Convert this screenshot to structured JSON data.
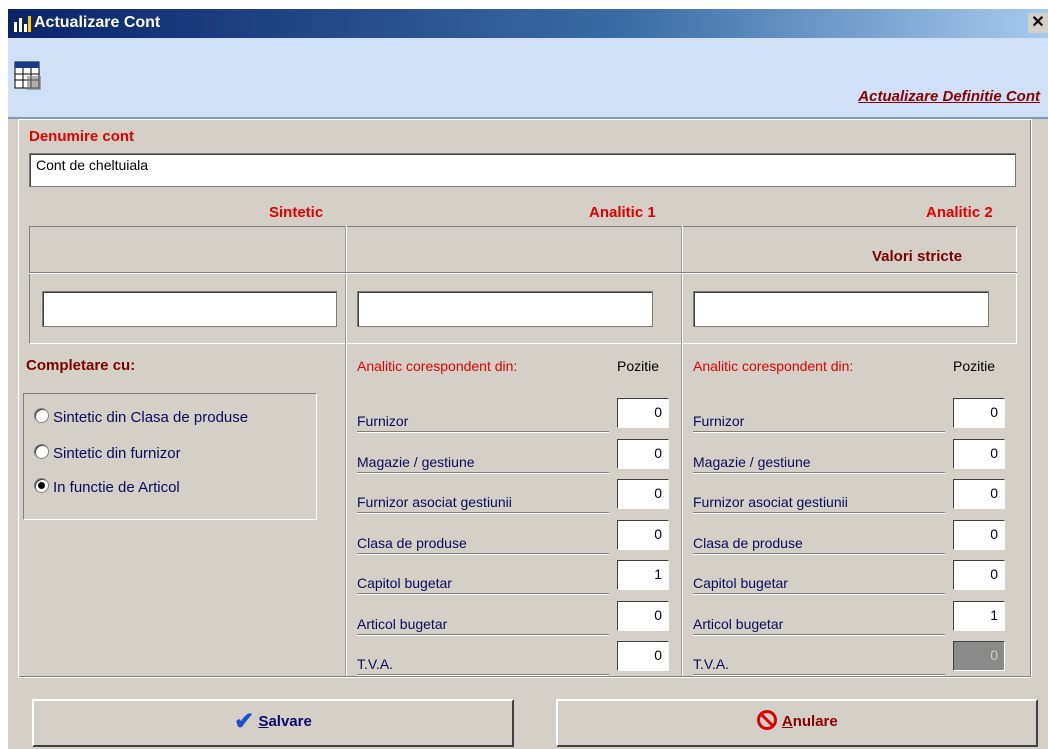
{
  "window": {
    "title": "Actualizare Cont",
    "close_glyph": "✕"
  },
  "banner": {
    "title": "Actualizare Definitie Cont",
    "icon": "table-grid-icon"
  },
  "account": {
    "name_label": "Denumire cont",
    "name_value": "Cont de cheltuiala"
  },
  "columns": {
    "sintetic": "Sintetic",
    "analitic1": "Analitic 1",
    "analitic2": "Analitic 2",
    "valori_stricte": "Valori stricte",
    "sintetic_value": "",
    "analitic1_value": "",
    "analitic2_value": ""
  },
  "completare": {
    "label": "Completare cu:",
    "options": [
      {
        "label": "Sintetic din Clasa de produse",
        "selected": false
      },
      {
        "label": "Sintetic din furnizor",
        "selected": false
      },
      {
        "label": "In functie de Articol",
        "selected": true
      }
    ]
  },
  "analitic1": {
    "header": "Analitic corespondent din:",
    "pos_header": "Pozitie",
    "rows": [
      {
        "label": "Furnizor",
        "value": "0"
      },
      {
        "label": "Magazie / gestiune",
        "value": "0"
      },
      {
        "label": "Furnizor asociat gestiunii",
        "value": "0"
      },
      {
        "label": "Clasa de produse",
        "value": "0"
      },
      {
        "label": "Capitol bugetar",
        "value": "1"
      },
      {
        "label": "Articol bugetar",
        "value": "0"
      },
      {
        "label": "T.V.A.",
        "value": "0"
      }
    ]
  },
  "analitic2": {
    "header": "Analitic corespondent din:",
    "pos_header": "Pozitie",
    "rows": [
      {
        "label": "Furnizor",
        "value": "0"
      },
      {
        "label": "Magazie / gestiune",
        "value": "0"
      },
      {
        "label": "Furnizor asociat gestiunii",
        "value": "0"
      },
      {
        "label": "Clasa de produse",
        "value": "0"
      },
      {
        "label": "Capitol bugetar",
        "value": "0"
      },
      {
        "label": "Articol bugetar",
        "value": "1"
      },
      {
        "label": "T.V.A.",
        "value": "0"
      }
    ]
  },
  "buttons": {
    "save_mnemonic": "S",
    "save_rest": "alvare",
    "cancel_mnemonic": "A",
    "cancel_rest": "nulare"
  },
  "colors": {
    "accent_red": "#e00000",
    "title_dark": "#8a0000",
    "banner_bg": "#cfe0f7",
    "window_bg": "#d4d0c8"
  }
}
